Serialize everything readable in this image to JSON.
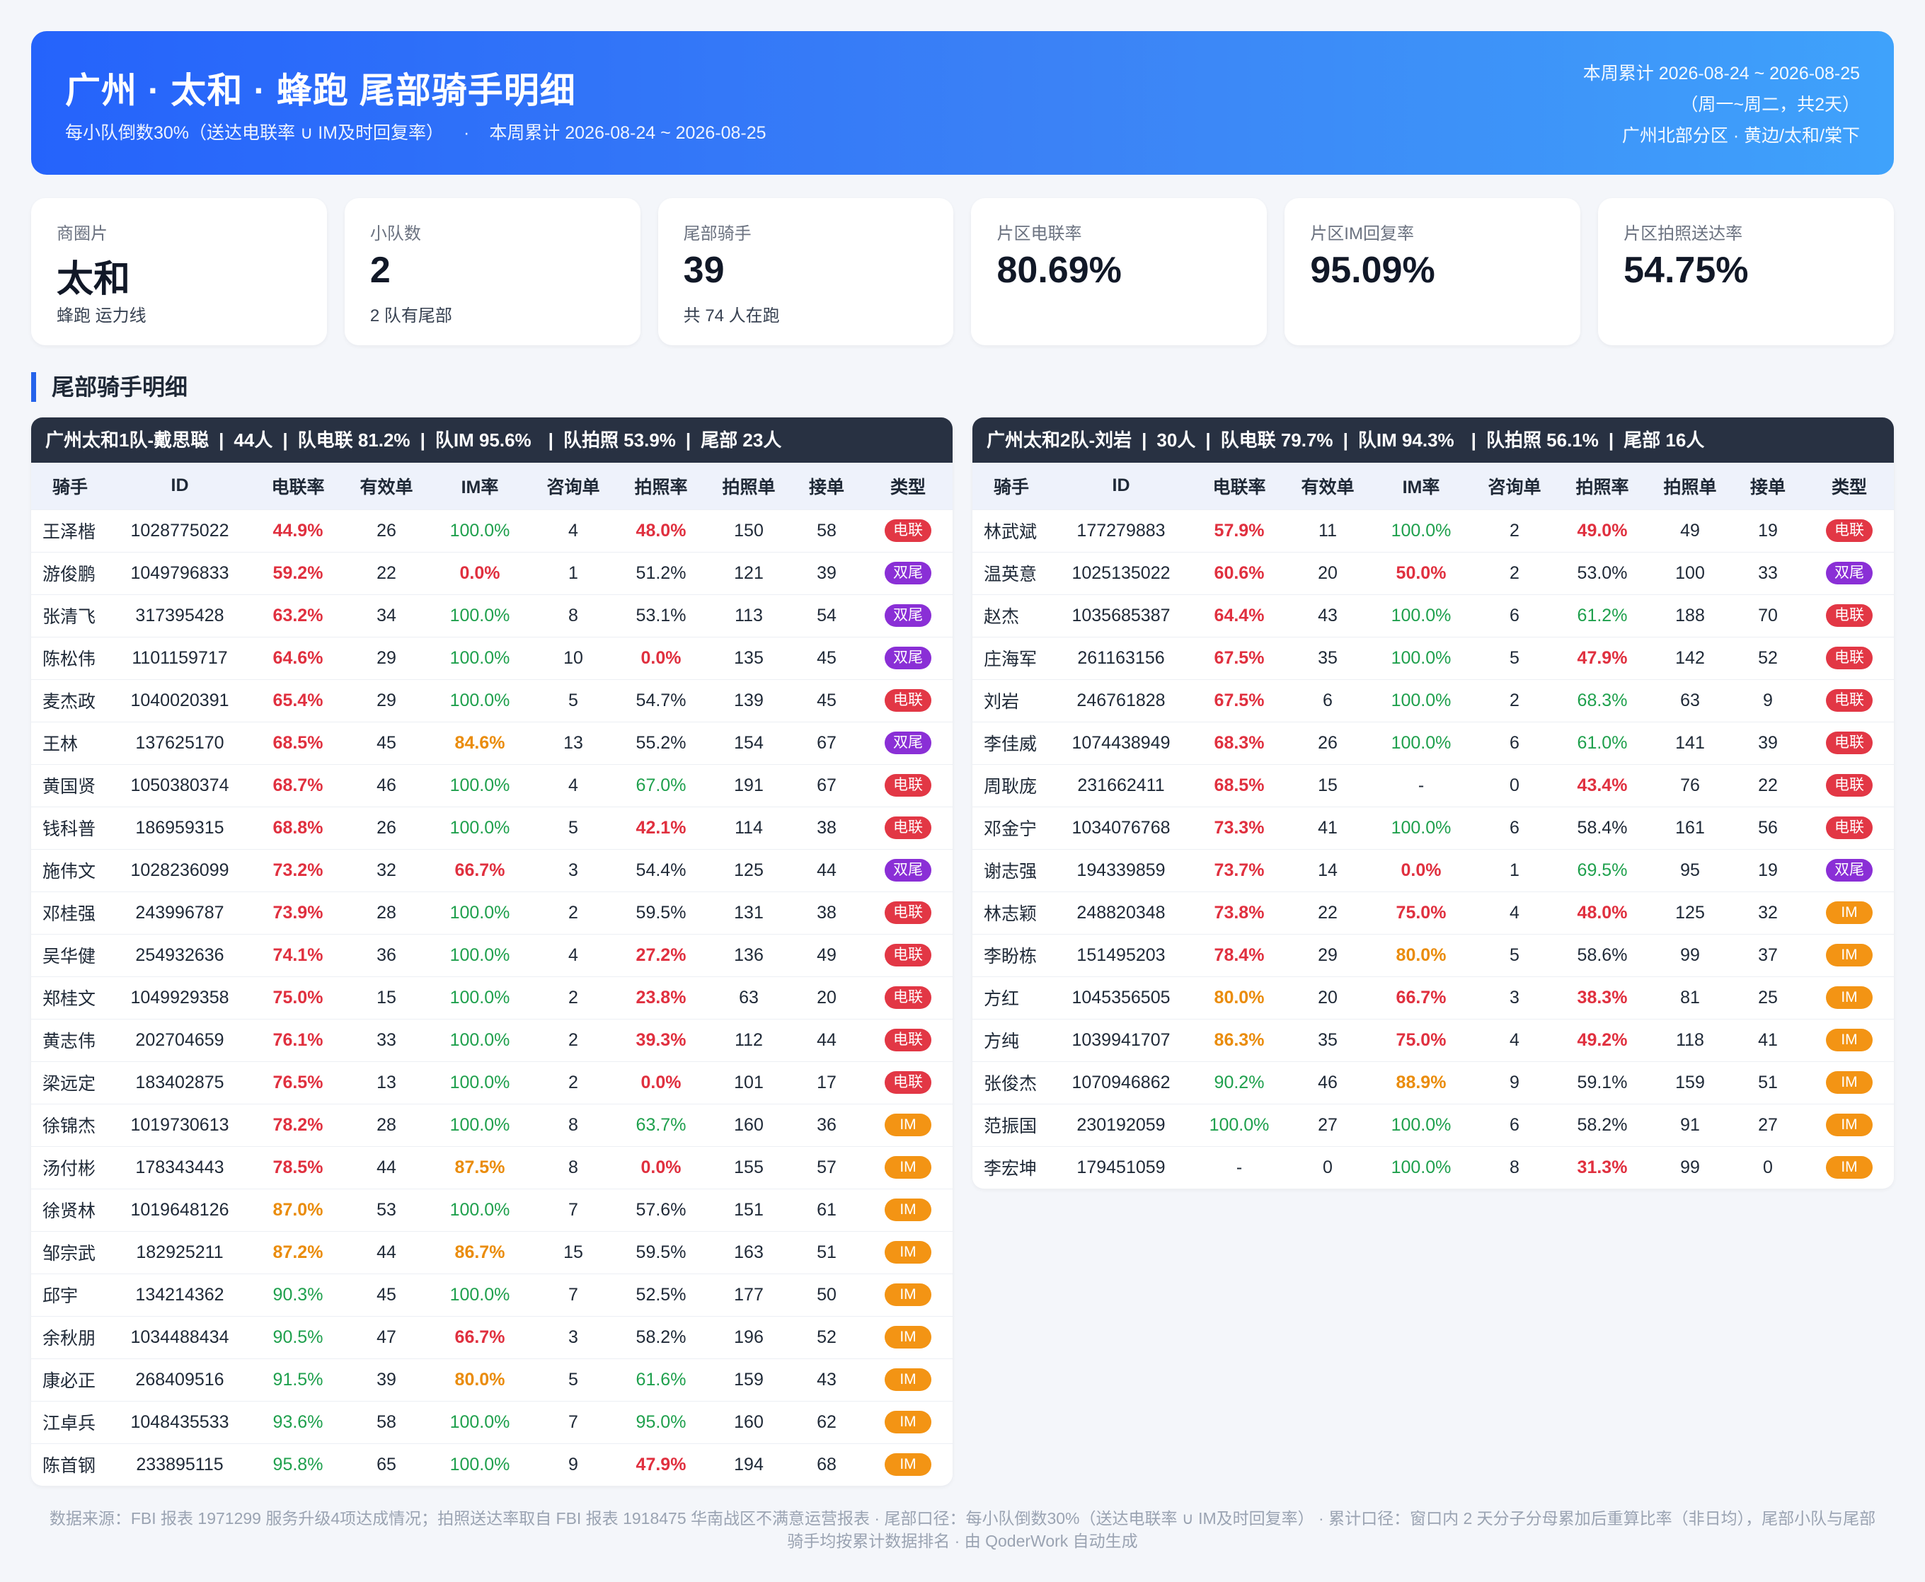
{
  "header": {
    "title": "广州 · 太和 · 蜂跑 尾部骑手明细",
    "subtitle_left": "每小队倒数30%（送达电联率 ∪ IM及时回复率）",
    "subtitle_sep": "·",
    "subtitle_right": "本周累计 2026-08-24 ~ 2026-08-25",
    "right_line1": "本周累计 2026-08-24 ~ 2026-08-25",
    "right_line2": "（周一~周二，共2天）",
    "right_line3": "广州北部分区 · 黄边/太和/棠下"
  },
  "cards": [
    {
      "label": "商圈片",
      "value": "太和",
      "sub": "蜂跑 运力线"
    },
    {
      "label": "小队数",
      "value": "2",
      "sub": "2 队有尾部"
    },
    {
      "label": "尾部骑手",
      "value": "39",
      "sub": "共 74 人在跑"
    },
    {
      "label": "片区电联率",
      "value": "80.69%",
      "sub": ""
    },
    {
      "label": "片区IM回复率",
      "value": "95.09%",
      "sub": ""
    },
    {
      "label": "片区拍照送达率",
      "value": "54.75%",
      "sub": ""
    }
  ],
  "section_title": "尾部骑手明细",
  "columns": [
    "骑手",
    "ID",
    "电联率",
    "有效单",
    "IM率",
    "咨询单",
    "拍照率",
    "拍照单",
    "接单",
    "类型"
  ],
  "badge_colors": {
    "电联": "#e23745",
    "双尾": "#8a2fd6",
    "IM": "#f39414"
  },
  "teams": [
    {
      "bar": {
        "name": "广州太和1队-戴思聪",
        "count": "44人",
        "dl": "队电联 81.2%",
        "im": "队IM 95.6%",
        "photo": "队拍照 53.9%",
        "tail": "尾部 23人"
      },
      "rows": [
        [
          "王泽楷",
          "1028775022",
          "44.9%",
          "26",
          "100.0%",
          "4",
          "48.0%",
          "150",
          "58",
          "电联"
        ],
        [
          "游俊鹏",
          "1049796833",
          "59.2%",
          "22",
          "0.0%",
          "1",
          "51.2%",
          "121",
          "39",
          "双尾"
        ],
        [
          "张清飞",
          "317395428",
          "63.2%",
          "34",
          "100.0%",
          "8",
          "53.1%",
          "113",
          "54",
          "双尾"
        ],
        [
          "陈松伟",
          "1101159717",
          "64.6%",
          "29",
          "100.0%",
          "10",
          "0.0%",
          "135",
          "45",
          "双尾"
        ],
        [
          "麦杰政",
          "1040020391",
          "65.4%",
          "29",
          "100.0%",
          "5",
          "54.7%",
          "139",
          "45",
          "电联"
        ],
        [
          "王林",
          "137625170",
          "68.5%",
          "45",
          "84.6%",
          "13",
          "55.2%",
          "154",
          "67",
          "双尾"
        ],
        [
          "黄国贤",
          "1050380374",
          "68.7%",
          "46",
          "100.0%",
          "4",
          "67.0%",
          "191",
          "67",
          "电联"
        ],
        [
          "钱科普",
          "186959315",
          "68.8%",
          "26",
          "100.0%",
          "5",
          "42.1%",
          "114",
          "38",
          "电联"
        ],
        [
          "施伟文",
          "1028236099",
          "73.2%",
          "32",
          "66.7%",
          "3",
          "54.4%",
          "125",
          "44",
          "双尾"
        ],
        [
          "邓桂强",
          "243996787",
          "73.9%",
          "28",
          "100.0%",
          "2",
          "59.5%",
          "131",
          "38",
          "电联"
        ],
        [
          "吴华健",
          "254932636",
          "74.1%",
          "36",
          "100.0%",
          "4",
          "27.2%",
          "136",
          "49",
          "电联"
        ],
        [
          "郑桂文",
          "1049929358",
          "75.0%",
          "15",
          "100.0%",
          "2",
          "23.8%",
          "63",
          "20",
          "电联"
        ],
        [
          "黄志伟",
          "202704659",
          "76.1%",
          "33",
          "100.0%",
          "2",
          "39.3%",
          "112",
          "44",
          "电联"
        ],
        [
          "梁远定",
          "183402875",
          "76.5%",
          "13",
          "100.0%",
          "2",
          "0.0%",
          "101",
          "17",
          "电联"
        ],
        [
          "徐锦杰",
          "1019730613",
          "78.2%",
          "28",
          "100.0%",
          "8",
          "63.7%",
          "160",
          "36",
          "IM"
        ],
        [
          "汤付彬",
          "178343443",
          "78.5%",
          "44",
          "87.5%",
          "8",
          "0.0%",
          "155",
          "57",
          "IM"
        ],
        [
          "徐贤林",
          "1019648126",
          "87.0%",
          "53",
          "100.0%",
          "7",
          "57.6%",
          "151",
          "61",
          "IM"
        ],
        [
          "邹宗武",
          "182925211",
          "87.2%",
          "44",
          "86.7%",
          "15",
          "59.5%",
          "163",
          "51",
          "IM"
        ],
        [
          "邱宇",
          "134214362",
          "90.3%",
          "45",
          "100.0%",
          "7",
          "52.5%",
          "177",
          "50",
          "IM"
        ],
        [
          "余秋朋",
          "1034488434",
          "90.5%",
          "47",
          "66.7%",
          "3",
          "58.2%",
          "196",
          "52",
          "IM"
        ],
        [
          "康必正",
          "268409516",
          "91.5%",
          "39",
          "80.0%",
          "5",
          "61.6%",
          "159",
          "43",
          "IM"
        ],
        [
          "江卓兵",
          "1048435533",
          "93.6%",
          "58",
          "100.0%",
          "7",
          "95.0%",
          "160",
          "62",
          "IM"
        ],
        [
          "陈首钢",
          "233895115",
          "95.8%",
          "65",
          "100.0%",
          "9",
          "47.9%",
          "194",
          "68",
          "IM"
        ]
      ],
      "styles": [
        [
          "",
          "",
          "red",
          "",
          "green",
          "",
          "red",
          "",
          "",
          ""
        ],
        [
          "",
          "",
          "red",
          "",
          "red",
          "",
          "",
          "",
          "",
          ""
        ],
        [
          "",
          "",
          "red",
          "",
          "green",
          "",
          "",
          "",
          "",
          ""
        ],
        [
          "",
          "",
          "red",
          "",
          "green",
          "",
          "red",
          "",
          "",
          ""
        ],
        [
          "",
          "",
          "red",
          "",
          "green",
          "",
          "",
          "",
          "",
          ""
        ],
        [
          "",
          "",
          "red",
          "",
          "orange",
          "",
          "",
          "",
          "",
          ""
        ],
        [
          "",
          "",
          "red",
          "",
          "green",
          "",
          "green",
          "",
          "",
          ""
        ],
        [
          "",
          "",
          "red",
          "",
          "green",
          "",
          "red",
          "",
          "",
          ""
        ],
        [
          "",
          "",
          "red",
          "",
          "red",
          "",
          "",
          "",
          "",
          ""
        ],
        [
          "",
          "",
          "red",
          "",
          "green",
          "",
          "",
          "",
          "",
          ""
        ],
        [
          "",
          "",
          "red",
          "",
          "green",
          "",
          "red",
          "",
          "",
          ""
        ],
        [
          "",
          "",
          "red",
          "",
          "green",
          "",
          "red",
          "",
          "",
          ""
        ],
        [
          "",
          "",
          "red",
          "",
          "green",
          "",
          "red",
          "",
          "",
          ""
        ],
        [
          "",
          "",
          "red",
          "",
          "green",
          "",
          "red",
          "",
          "",
          ""
        ],
        [
          "",
          "",
          "red",
          "",
          "green",
          "",
          "green",
          "",
          "",
          ""
        ],
        [
          "",
          "",
          "red",
          "",
          "orange",
          "",
          "red",
          "",
          "",
          ""
        ],
        [
          "",
          "",
          "orange",
          "",
          "green",
          "",
          "",
          "",
          "",
          ""
        ],
        [
          "",
          "",
          "orange",
          "",
          "orange",
          "",
          "",
          "",
          "",
          ""
        ],
        [
          "",
          "",
          "green",
          "",
          "green",
          "",
          "",
          "",
          "",
          ""
        ],
        [
          "",
          "",
          "green",
          "",
          "red",
          "",
          "",
          "",
          "",
          ""
        ],
        [
          "",
          "",
          "green",
          "",
          "orange",
          "",
          "green",
          "",
          "",
          ""
        ],
        [
          "",
          "",
          "green",
          "",
          "green",
          "",
          "green",
          "",
          "",
          ""
        ],
        [
          "",
          "",
          "green",
          "",
          "green",
          "",
          "red",
          "",
          "",
          ""
        ]
      ]
    },
    {
      "bar": {
        "name": "广州太和2队-刘岩",
        "count": "30人",
        "dl": "队电联 79.7%",
        "im": "队IM 94.3%",
        "photo": "队拍照 56.1%",
        "tail": "尾部 16人"
      },
      "rows": [
        [
          "林武斌",
          "177279883",
          "57.9%",
          "11",
          "100.0%",
          "2",
          "49.0%",
          "49",
          "19",
          "电联"
        ],
        [
          "温英意",
          "1025135022",
          "60.6%",
          "20",
          "50.0%",
          "2",
          "53.0%",
          "100",
          "33",
          "双尾"
        ],
        [
          "赵杰",
          "1035685387",
          "64.4%",
          "43",
          "100.0%",
          "6",
          "61.2%",
          "188",
          "70",
          "电联"
        ],
        [
          "庄海军",
          "261163156",
          "67.5%",
          "35",
          "100.0%",
          "5",
          "47.9%",
          "142",
          "52",
          "电联"
        ],
        [
          "刘岩",
          "246761828",
          "67.5%",
          "6",
          "100.0%",
          "2",
          "68.3%",
          "63",
          "9",
          "电联"
        ],
        [
          "李佳威",
          "1074438949",
          "68.3%",
          "26",
          "100.0%",
          "6",
          "61.0%",
          "141",
          "39",
          "电联"
        ],
        [
          "周耿庞",
          "231662411",
          "68.5%",
          "15",
          "-",
          "0",
          "43.4%",
          "76",
          "22",
          "电联"
        ],
        [
          "邓金宁",
          "1034076768",
          "73.3%",
          "41",
          "100.0%",
          "6",
          "58.4%",
          "161",
          "56",
          "电联"
        ],
        [
          "谢志强",
          "194339859",
          "73.7%",
          "14",
          "0.0%",
          "1",
          "69.5%",
          "95",
          "19",
          "双尾"
        ],
        [
          "林志颖",
          "248820348",
          "73.8%",
          "22",
          "75.0%",
          "4",
          "48.0%",
          "125",
          "32",
          "IM"
        ],
        [
          "李盼栋",
          "151495203",
          "78.4%",
          "29",
          "80.0%",
          "5",
          "58.6%",
          "99",
          "37",
          "IM"
        ],
        [
          "方红",
          "1045356505",
          "80.0%",
          "20",
          "66.7%",
          "3",
          "38.3%",
          "81",
          "25",
          "IM"
        ],
        [
          "方纯",
          "1039941707",
          "86.3%",
          "35",
          "75.0%",
          "4",
          "49.2%",
          "118",
          "41",
          "IM"
        ],
        [
          "张俊杰",
          "1070946862",
          "90.2%",
          "46",
          "88.9%",
          "9",
          "59.1%",
          "159",
          "51",
          "IM"
        ],
        [
          "范振国",
          "230192059",
          "100.0%",
          "27",
          "100.0%",
          "6",
          "58.2%",
          "91",
          "27",
          "IM"
        ],
        [
          "李宏坤",
          "179451059",
          "-",
          "0",
          "100.0%",
          "8",
          "31.3%",
          "99",
          "0",
          "IM"
        ]
      ],
      "styles": [
        [
          "",
          "",
          "red",
          "",
          "green",
          "",
          "red",
          "",
          "",
          ""
        ],
        [
          "",
          "",
          "red",
          "",
          "red",
          "",
          "",
          "",
          "",
          ""
        ],
        [
          "",
          "",
          "red",
          "",
          "green",
          "",
          "green",
          "",
          "",
          ""
        ],
        [
          "",
          "",
          "red",
          "",
          "green",
          "",
          "red",
          "",
          "",
          ""
        ],
        [
          "",
          "",
          "red",
          "",
          "green",
          "",
          "green",
          "",
          "",
          ""
        ],
        [
          "",
          "",
          "red",
          "",
          "green",
          "",
          "green",
          "",
          "",
          ""
        ],
        [
          "",
          "",
          "red",
          "",
          "",
          "",
          "red",
          "",
          "",
          ""
        ],
        [
          "",
          "",
          "red",
          "",
          "green",
          "",
          "",
          "",
          "",
          ""
        ],
        [
          "",
          "",
          "red",
          "",
          "red",
          "",
          "green",
          "",
          "",
          ""
        ],
        [
          "",
          "",
          "red",
          "",
          "red",
          "",
          "red",
          "",
          "",
          ""
        ],
        [
          "",
          "",
          "red",
          "",
          "orange",
          "",
          "",
          "",
          "",
          ""
        ],
        [
          "",
          "",
          "orange",
          "",
          "red",
          "",
          "red",
          "",
          "",
          ""
        ],
        [
          "",
          "",
          "orange",
          "",
          "red",
          "",
          "red",
          "",
          "",
          ""
        ],
        [
          "",
          "",
          "green",
          "",
          "orange",
          "",
          "",
          "",
          "",
          ""
        ],
        [
          "",
          "",
          "green",
          "",
          "green",
          "",
          "",
          "",
          "",
          ""
        ],
        [
          "",
          "",
          "",
          "",
          "green",
          "",
          "red",
          "",
          "",
          ""
        ]
      ]
    }
  ],
  "footer": {
    "line1": "数据来源：FBI 报表 1971299 服务升级4项达成情况；拍照送达率取自 FBI 报表 1918475 华南战区不满意运营报表 · 尾部口径：每小队倒数30%（送达电联率 ∪ IM及时回复率） · 累计口径：窗口内 2 天分子分母累加后重算比率（非日均），尾部小队与尾部",
    "line2": "骑手均按累计数据排名 · 由 QoderWork 自动生成"
  }
}
